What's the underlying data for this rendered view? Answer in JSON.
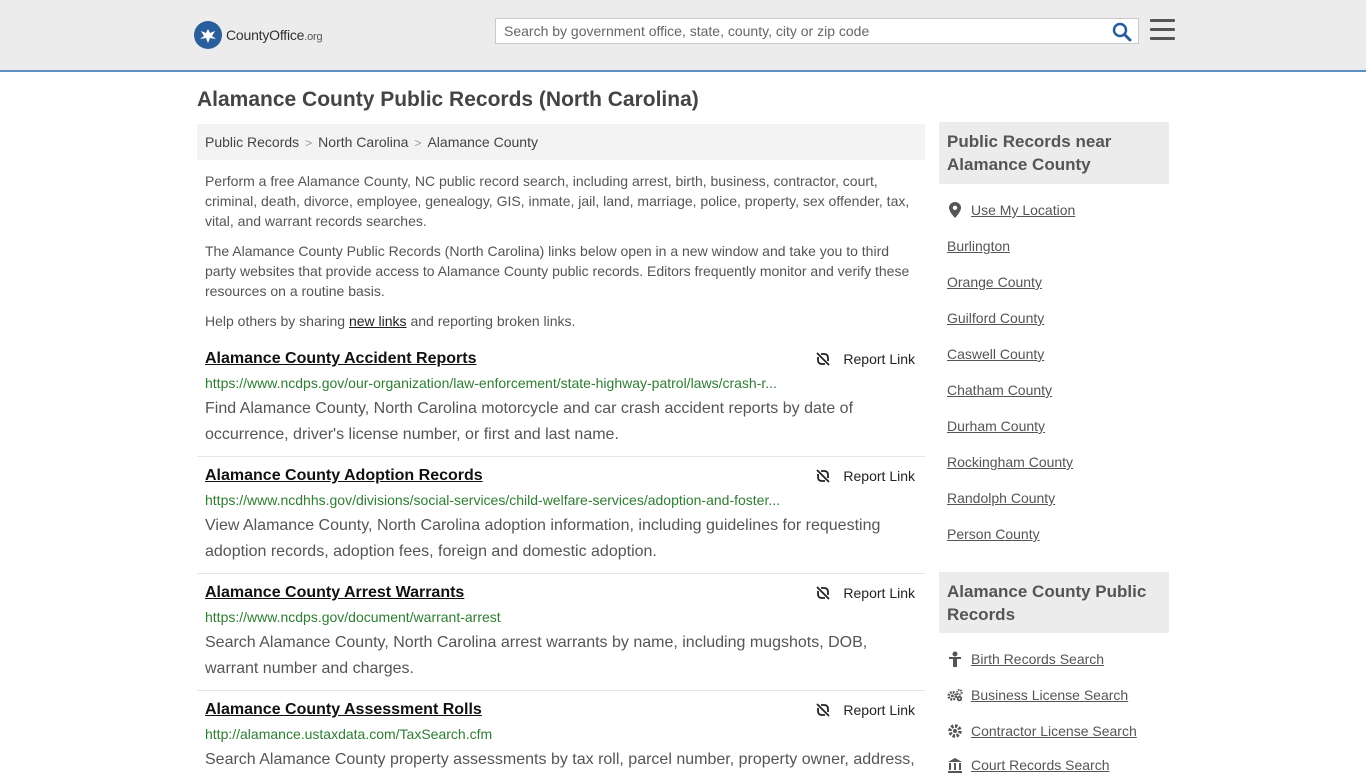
{
  "header": {
    "logo_text_main": "CountyOffice",
    "logo_text_tld": ".org",
    "search_placeholder": "Search by government office, state, county, city or zip code"
  },
  "page_title": "Alamance County Public Records (North Carolina)",
  "breadcrumb": [
    "Public Records",
    "North Carolina",
    "Alamance County"
  ],
  "intro": {
    "p1": "Perform a free Alamance County, NC public record search, including arrest, birth, business, contractor, court, criminal, death, divorce, employee, genealogy, GIS, inmate, jail, land, marriage, police, property, sex offender, tax, vital, and warrant records searches.",
    "p2": "The Alamance County Public Records (North Carolina) links below open in a new window and take you to third party websites that provide access to Alamance County public records. Editors frequently monitor and verify these resources on a routine basis.",
    "p3_before": "Help others by sharing ",
    "p3_link": "new links",
    "p3_after": " and reporting broken links."
  },
  "report_label": "Report Link",
  "records": [
    {
      "title": "Alamance County Accident Reports",
      "url": "https://www.ncdps.gov/our-organization/law-enforcement/state-highway-patrol/laws/crash-r...",
      "desc": "Find Alamance County, North Carolina motorcycle and car crash accident reports by date of occurrence, driver's license number, or first and last name."
    },
    {
      "title": "Alamance County Adoption Records",
      "url": "https://www.ncdhhs.gov/divisions/social-services/child-welfare-services/adoption-and-foster...",
      "desc": "View Alamance County, North Carolina adoption information, including guidelines for requesting adoption records, adoption fees, foreign and domestic adoption."
    },
    {
      "title": "Alamance County Arrest Warrants",
      "url": "https://www.ncdps.gov/document/warrant-arrest",
      "desc": "Search Alamance County, North Carolina arrest warrants by name, including mugshots, DOB, warrant number and charges."
    },
    {
      "title": "Alamance County Assessment Rolls",
      "url": "http://alamance.ustaxdata.com/TaxSearch.cfm",
      "desc": "Search Alamance County property assessments by tax roll, parcel number, property owner, address,"
    }
  ],
  "sidebar": {
    "near_heading": "Public Records near Alamance County",
    "use_location": "Use My Location",
    "near_links": [
      "Burlington",
      "Orange County",
      "Guilford County",
      "Caswell County",
      "Chatham County",
      "Durham County",
      "Rockingham County",
      "Randolph County",
      "Person County"
    ],
    "records_heading": "Alamance County Public Records",
    "record_links": [
      "Birth Records Search",
      "Business License Search",
      "Contractor License Search",
      "Court Records Search"
    ]
  },
  "colors": {
    "brand_blue": "#2a5d9b",
    "url_green": "#2e7d32",
    "header_bg": "#ececec"
  }
}
